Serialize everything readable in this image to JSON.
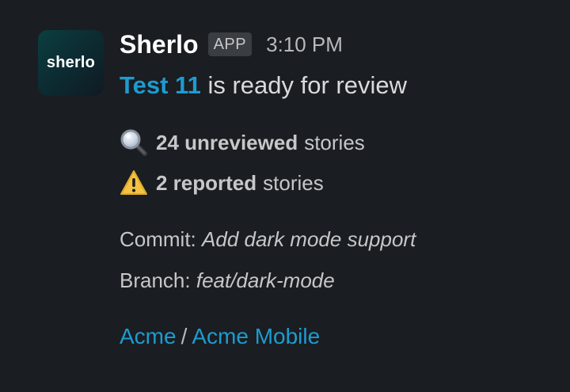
{
  "avatar": {
    "label": "sherlo"
  },
  "header": {
    "sender": "Sherlo",
    "badge": "APP",
    "time": "3:10 PM"
  },
  "headline": {
    "link": "Test 11",
    "text": "is ready for review"
  },
  "stats": [
    {
      "icon": "magnifying-glass-icon",
      "count": "24 unreviewed",
      "suffix": "stories"
    },
    {
      "icon": "warning-icon",
      "count": "2 reported",
      "suffix": "stories"
    }
  ],
  "meta": {
    "commit_label": "Commit:",
    "commit_value": "Add dark mode support",
    "branch_label": "Branch:",
    "branch_value": "feat/dark-mode"
  },
  "footer": {
    "org": "Acme",
    "separator": "/",
    "project": "Acme Mobile"
  },
  "colors": {
    "background": "#1a1d21",
    "link": "#1d9bd1",
    "text": "#d1d2d3"
  }
}
